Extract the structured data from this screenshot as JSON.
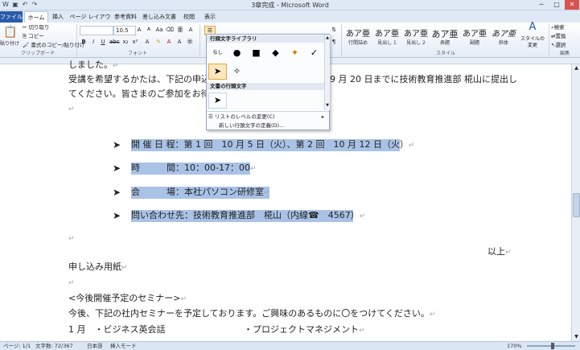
{
  "window": {
    "title": "3章完成 - Microsoft Word",
    "minimize_glyph": "─",
    "maximize_glyph": "□",
    "close_glyph": "✕"
  },
  "qat": {
    "save_glyph": "▣",
    "undo_glyph": "↶",
    "redo_glyph": "↷"
  },
  "tabs": [
    {
      "label": "ファイル"
    },
    {
      "label": "ホーム"
    },
    {
      "label": "挿入"
    },
    {
      "label": "ページ レイアウト"
    },
    {
      "label": "参考資料"
    },
    {
      "label": "差し込み文書"
    },
    {
      "label": "校閲"
    },
    {
      "label": "表示"
    }
  ],
  "ribbon": {
    "clipboard": {
      "paste": "貼り付け",
      "cut": "切り取り",
      "copy": "コピー",
      "format_painter": "書式のコピー/貼り付け",
      "group": "クリップボード"
    },
    "font": {
      "font_size": "10.5",
      "grow": "A",
      "shrink": "A",
      "case": "Aa",
      "bold": "B",
      "italic": "I",
      "underline": "U",
      "group": "フォント"
    },
    "styles": {
      "items": [
        {
          "preview": "あア亜",
          "label": "行間詰め"
        },
        {
          "preview": "あア亜",
          "label": "見出し 1"
        },
        {
          "preview": "あア亜",
          "label": "見出し 2"
        },
        {
          "preview": "あア亜",
          "label": "表題"
        },
        {
          "preview": "あア亜",
          "label": "副題"
        },
        {
          "preview": "あア亜",
          "label": "斜体"
        }
      ],
      "change": "スタイルの変更",
      "group": "スタイル"
    },
    "editing": {
      "find": "検索",
      "replace": "置換",
      "select": "選択",
      "group": "編集"
    }
  },
  "bullet_menu": {
    "library_header": "行頭文字ライブラリ",
    "none_label": "なし",
    "library": [
      "●",
      "■",
      "◆",
      "✦",
      "✓"
    ],
    "selected": "➤",
    "document_header": "文書の行頭文字",
    "document": [
      "➤"
    ],
    "change_level": "リストのレベルの変更(C)",
    "define_new": "新しい行頭文字の定義(D)..."
  },
  "document": {
    "lines": [
      {
        "text": "しました。"
      },
      {
        "text": "受講を希望するかたは、下記の申込"
      },
      {
        "text": "9 月 20 日までに技術教育推進部 椛山に提出し"
      },
      {
        "text": "てください。皆さまのご参加をお待"
      },
      {
        "text": ""
      },
      {
        "text": "開 催 日 程：第 1 回　10 月 5 日（火）、第 2 回　10 月 12 日（火）"
      },
      {
        "text": "時　　　間：10：00-17：00"
      },
      {
        "text": "会　　　場：本社パソコン研修室"
      },
      {
        "text": "問い合わせ先：技術教育推進部　椛山（内線☎　4567）"
      },
      {
        "text": ""
      },
      {
        "text": "以上"
      },
      {
        "text": "申し込み用紙"
      },
      {
        "text": ""
      },
      {
        "text": "<今後開催予定のセミナー>"
      },
      {
        "text": "今後、下記の社内セミナーを予定しております。ご興味のあるものに〇をつけてください。"
      },
      {
        "text": "1 月　・ビジネス英会話"
      },
      {
        "text": "・プロジェクトマネジメント"
      }
    ],
    "bullet_glyph": "➤",
    "paragraph_mark": "↵"
  },
  "status": {
    "page": "ページ: 1/1",
    "words": "文字数: 72/367",
    "language": "日本語",
    "mode": "挿入モード",
    "zoom": "170%"
  },
  "colors": {
    "accent": "#2a5caa",
    "highlight": "#a9c2e6",
    "menu_selected": "#fde9bd"
  }
}
